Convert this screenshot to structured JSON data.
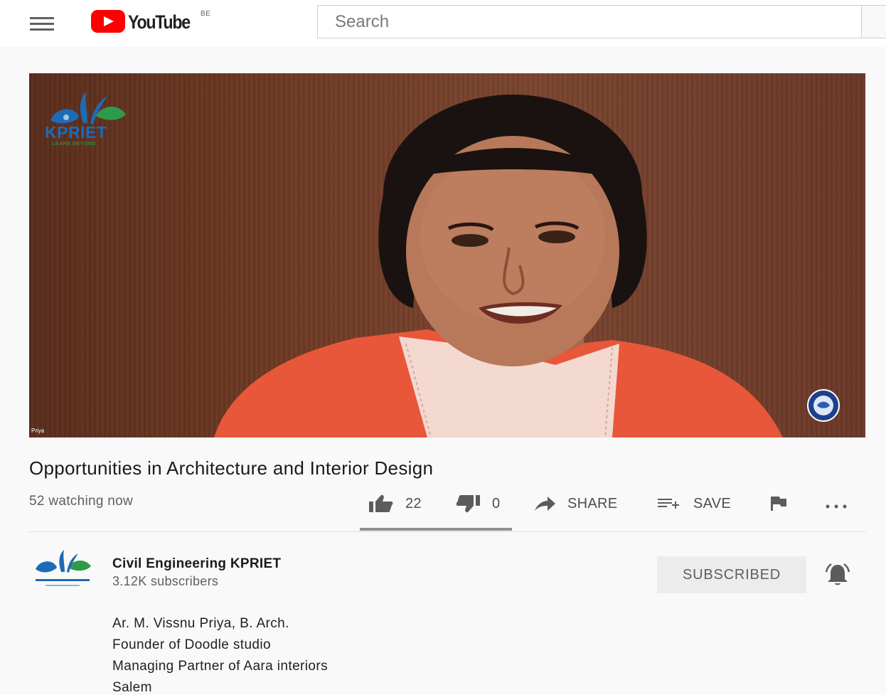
{
  "header": {
    "brand": "YouTube",
    "country_code": "BE",
    "search_placeholder": "Search"
  },
  "video": {
    "overlay_logo_text": "KPRIET",
    "overlay_logo_tagline": "LEARN BEYOND",
    "participant_name": "Priya"
  },
  "title": "Opportunities in Architecture and Interior Design",
  "watching": "52 watching now",
  "actions": {
    "likes": "22",
    "dislikes": "0",
    "share_label": "SHARE",
    "save_label": "SAVE"
  },
  "channel": {
    "name": "Civil Engineering KPRIET",
    "subscribers": "3.12K subscribers",
    "subscribed_label": "SUBSCRIBED"
  },
  "description": [
    "Ar. M. Vissnu Priya, B. Arch.",
    "Founder of Doodle studio",
    "Managing Partner of Aara interiors",
    "Salem"
  ],
  "colors": {
    "brand_red": "#ff0000",
    "kpriet_blue": "#1d6bb8",
    "kpriet_green": "#2e8b3a"
  },
  "icons": [
    "menu-icon",
    "youtube-play-icon",
    "thumb-up-icon",
    "thumb-down-icon",
    "share-icon",
    "save-playlist-icon",
    "flag-icon",
    "more-icon",
    "bell-icon"
  ]
}
